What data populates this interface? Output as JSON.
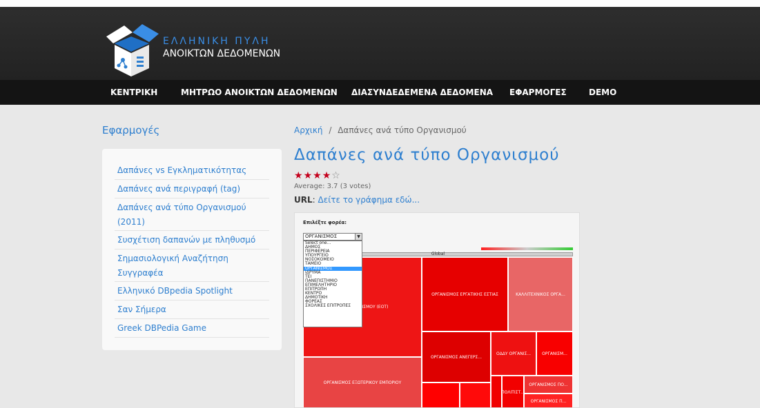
{
  "header": {
    "logo_line1": "ΕΛΛΗΝΙΚΗ ΠΥΛΗ",
    "logo_line2": "ΑΝΟΙΚΤΩΝ ΔΕΔΟΜΕΝΩΝ",
    "logo_icon": "open-box-icon",
    "colors": {
      "header_bg": "#2a2a2a",
      "nav_bg": "#141414",
      "accent": "#2e7fcf"
    }
  },
  "nav": {
    "items": [
      {
        "label": "ΚΕΝΤΡΙΚΗ"
      },
      {
        "label": "ΜΗΤΡΩΟ ΑΝΟΙΚΤΩΝ ΔΕΔΟΜΕΝΩΝ"
      },
      {
        "label": "ΔΙΑΣΥΝΔΕΔΕΜΕΝΑ ΔΕΔΟΜΕΝΑ"
      },
      {
        "label": "ΕΦΑΡΜΟΓΕΣ"
      },
      {
        "label": "DEMO"
      }
    ]
  },
  "sidebar": {
    "title": "Εφαρμογές",
    "items": [
      {
        "label": "Δαπάνες vs Εγκληματικότητας"
      },
      {
        "label": "Δαπάνες ανά περιγραφή (tag)"
      },
      {
        "label": "Δαπάνες ανά τύπο Οργανισμού (2011)"
      },
      {
        "label": "Συσχέτιση δαπανών με πληθυσμό"
      },
      {
        "label": "Σημασιολογική Αναζήτηση Συγγραφέα"
      },
      {
        "label": "Ελληνικό DBpedia Spotlight"
      },
      {
        "label": "Σαν Σήμερα"
      },
      {
        "label": "Greek DBPedia Game"
      }
    ]
  },
  "main": {
    "breadcrumb": {
      "home": "Αρχική",
      "separator": "/",
      "current": "Δαπάνες ανά τύπο Οργανισμού"
    },
    "title": "Δαπάνες ανά τύπο Οργανισμού",
    "rating": {
      "stars": 4,
      "max": 5,
      "average_text": "Average: 3.7 (3 votes)"
    },
    "url_label": "URL",
    "url_colon": ":",
    "url_link": "Δείτε το γράφημα εδώ..."
  },
  "chart_widget": {
    "filter_label": "Επιλέξτε φορέα:",
    "selected": "ΟΡΓΑΝΙΣΜΟΣ",
    "options": [
      "Select one...",
      "ΔΗΜΟΣ",
      "ΠΕΡΙΦΕΡΕΙΑ",
      "ΥΠΟΥΡΓΕΙΟ",
      "ΝΟΣΟΚΟΜΕΙΟ",
      "ΤΑΜΕΙΟ",
      "ΟΡΓΑΝΙΣΜΟΣ",
      "ΙΔΡΥΜΑ",
      "ΤΕΙ",
      "ΠΑΝΕΠΙΣΤΗΜΙΟ",
      "ΕΠΙΜΕΛΗΤΗΡΙΟ",
      "ΕΠΙΤΡΟΠΗ",
      "ΚΕΝΤΡΟ",
      "ΔΗΜΟΤΙΚΗ",
      "ΦΟΡΕΑΣ",
      "ΣΧΟΛΙΚΕΣ ΕΠΙΤΡΟΠΕΣ"
    ],
    "selected_index": 6,
    "global_label": "Global",
    "tiles": [
      {
        "label": "...ΜΟΣ ΤΟΥΡΙΣΜΟΥ (ΕΟΤ)",
        "color": "#ee1515"
      },
      {
        "label": "ΟΡΓΑΝΙΣΜΟΣ ΕΡΓΑΤΙΚΗΣ ΕΣΤΙΑΣ",
        "color": "#e60000"
      },
      {
        "label": "ΚΑΛΛΙΤΕΧΝΙΚΟΣ ΟΡΓΑ...",
        "color": "#e86666"
      },
      {
        "label": "ΟΡΓΑΝΙΣΜΟΣ ΑΝΕΓΕΡΣ...",
        "color": "#dd0000"
      },
      {
        "label": "ΟΔΔΥ ΟΡΓΑΝΙΣ...",
        "color": "#ee1111"
      },
      {
        "label": "ΟΡΓΑΝΙΣΜ...",
        "color": "#f80000"
      },
      {
        "label": "ΟΡΓΑΝΙΣΜΟΣ ΕΞΩΤΕΡΙΚΟΥ ΕΜΠΟΡΙΟΥ",
        "color": "#e84444"
      },
      {
        "label": "",
        "color": "#ff0000"
      },
      {
        "label": "",
        "color": "#ff0a0a"
      },
      {
        "label": "",
        "color": "#f00000"
      },
      {
        "label": "ΠΟΛΙΤΙΣΤ...",
        "color": "#f20000"
      },
      {
        "label": "ΟΡΓΑΝΙΣΜΟΣ ΠΟ...",
        "color": "#ee3333"
      },
      {
        "label": "ΟΡΓΑΝΙΣΜΟΣ Π...",
        "color": "#ff2222"
      }
    ]
  }
}
